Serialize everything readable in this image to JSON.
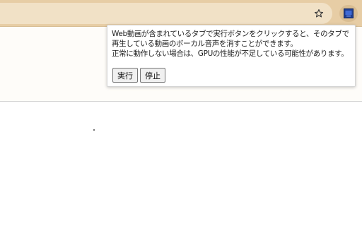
{
  "toolbar": {
    "bookmark_icon": "star-outline-icon",
    "extension_icon": "extension-app-icon",
    "colors": {
      "toolbar": "#e7cda5",
      "omnibox": "#f1e1c6",
      "extension": "#1f3e8f"
    }
  },
  "popup": {
    "lines": [
      "Web動画が含まれているタブで実行ボタンをクリックすると、そのタブで",
      "再生している動画のボーカル音声を消すことができます。",
      "正常に動作しない場合は、GPUの性能が不足している可能性があります。"
    ],
    "run_label": "実行",
    "stop_label": "停止"
  }
}
